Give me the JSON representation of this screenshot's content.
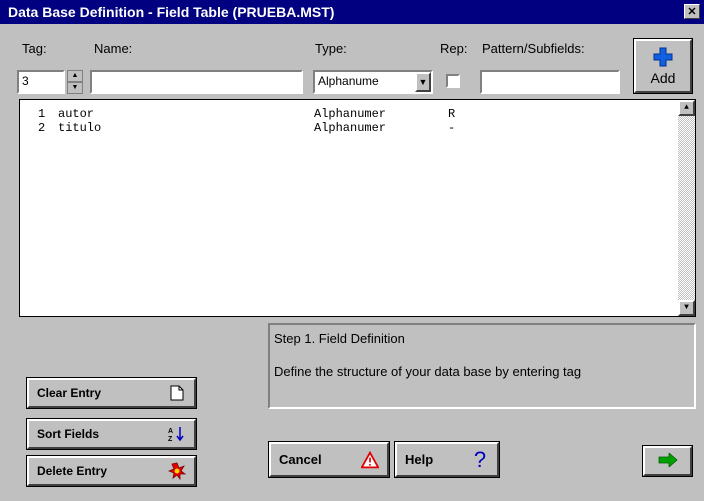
{
  "window": {
    "title": "Data Base Definition - Field Table (PRUEBA.MST)"
  },
  "labels": {
    "tag": "Tag:",
    "name": "Name:",
    "type": "Type:",
    "rep": "Rep:",
    "pattern": "Pattern/Subfields:"
  },
  "inputs": {
    "tag_value": "3",
    "name_value": "",
    "type_value": "Alphanume",
    "rep_checked": false,
    "pattern_value": ""
  },
  "add_button": {
    "label": "Add",
    "icon": "add-icon"
  },
  "fields": [
    {
      "num": "1",
      "name": "autor",
      "type": "Alphanumer",
      "rep": "R"
    },
    {
      "num": "2",
      "name": "titulo",
      "type": "Alphanumer",
      "rep": "-"
    }
  ],
  "step": {
    "title": "Step 1. Field Definition",
    "text": "Define the structure of your data base by entering tag"
  },
  "buttons": {
    "clear": "Clear Entry",
    "sort": "Sort Fields",
    "delete": "Delete Entry",
    "cancel": "Cancel",
    "help": "Help"
  },
  "colors": {
    "titlebar": "#000080",
    "face": "#c0c0c0",
    "arrow_green": "#00a000",
    "warning_red": "#e00000",
    "help_blue": "#0000c0"
  }
}
